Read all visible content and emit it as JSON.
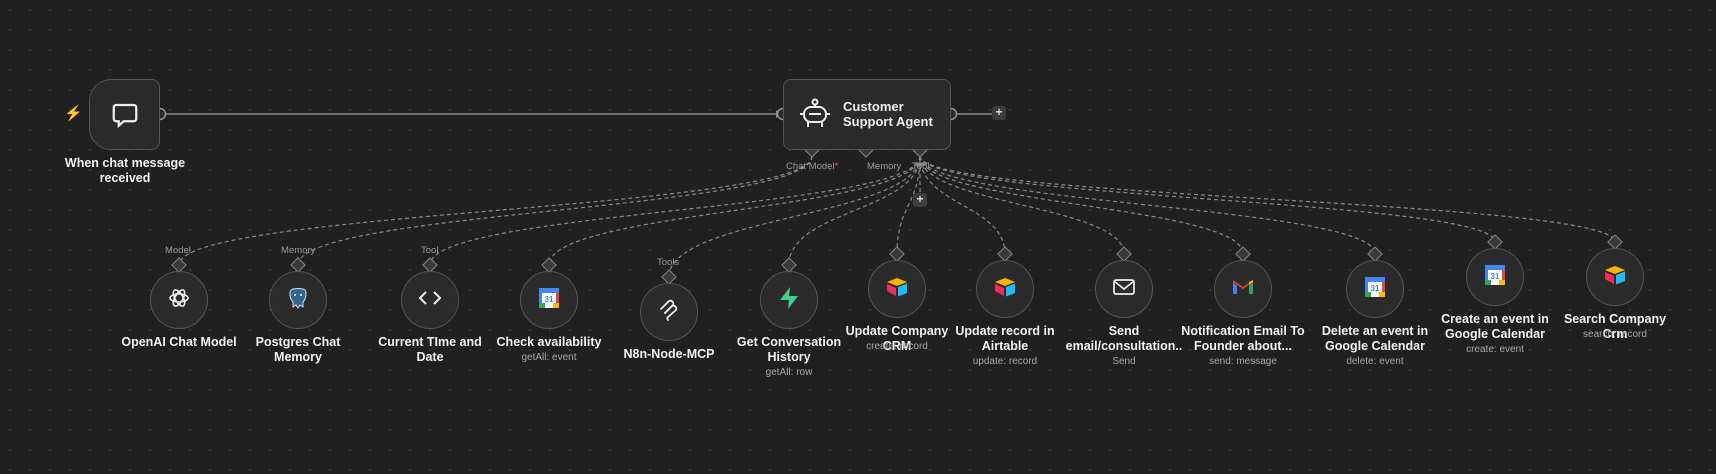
{
  "trigger": {
    "label": "When chat message received",
    "icon": "chat-bubble-icon"
  },
  "agent": {
    "title": "Customer Support Agent",
    "icon": "robot-icon",
    "slots": {
      "chat_model": "Chat Model",
      "chat_model_required": "*",
      "memory": "Memory",
      "tool": "Tool"
    }
  },
  "connector_labels": {
    "model": "Model",
    "memory": "Memory",
    "tool": "Tool",
    "tools": "Tools"
  },
  "tools": [
    {
      "label": "OpenAI Chat Model",
      "sub": "",
      "icon": "openai-icon"
    },
    {
      "label": "Postgres Chat Memory",
      "sub": "",
      "icon": "postgres-icon"
    },
    {
      "label": "Current TIme and Date",
      "sub": "",
      "icon": "code-icon"
    },
    {
      "label": "Check availability",
      "sub": "getAll: event",
      "icon": "google-calendar-icon"
    },
    {
      "label": "N8n-Node-MCP",
      "sub": "",
      "icon": "mcp-icon"
    },
    {
      "label": "Get Conversation History",
      "sub": "getAll: row",
      "icon": "supabase-icon"
    },
    {
      "label": "Update Company CRM",
      "sub": "create: record",
      "icon": "airtable-icon"
    },
    {
      "label": "Update record in Airtable",
      "sub": "update: record",
      "icon": "airtable-icon"
    },
    {
      "label": "Send email/consultation..",
      "sub": "Send",
      "icon": "mail-icon"
    },
    {
      "label": "Notification Email To Founder about...",
      "sub": "send: message",
      "icon": "gmail-icon"
    },
    {
      "label": "Delete an event in Google Calendar",
      "sub": "delete: event",
      "icon": "google-calendar-icon"
    },
    {
      "label": "Create an event in Google Calendar",
      "sub": "create: event",
      "icon": "google-calendar-icon"
    },
    {
      "label": "Search Company Crm",
      "sub": "search: record",
      "icon": "airtable-icon"
    }
  ],
  "colors": {
    "background": "#202020",
    "node": "#2b2b2b",
    "border": "#555555",
    "accent": "#ff6d2d"
  }
}
